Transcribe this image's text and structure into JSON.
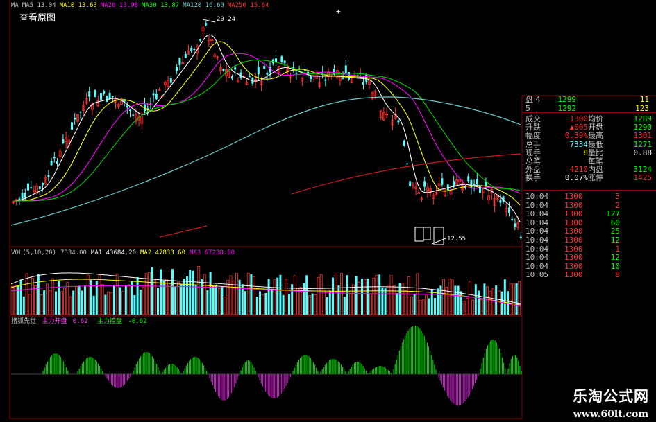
{
  "price_header": {
    "items": [
      {
        "label": "MA",
        "color": "#c0c0c0"
      },
      {
        "label": "MA5 13.04",
        "color": "#c0c0c0"
      },
      {
        "label": "MA10 13.63",
        "color": "#ffff00"
      },
      {
        "label": "MA20 13.98",
        "color": "#ff00ff"
      },
      {
        "label": "MA30 13.87",
        "color": "#00ff00"
      },
      {
        "label": "MA120 16.60",
        "color": "#7fd2d2"
      },
      {
        "label": "MA250 15.64",
        "color": "#ff3030"
      }
    ]
  },
  "view_original_label": "查看原图",
  "high_label": "20.24",
  "low_label": "12.55",
  "vol_header": {
    "items": [
      {
        "label": "VOL(5,10,20)",
        "color": "#c0c0c0"
      },
      {
        "label": "7334.00",
        "color": "#c0c0c0"
      },
      {
        "label": "MA1 43684.20",
        "color": "#ffffff"
      },
      {
        "label": "MA2 47833.60",
        "color": "#ffff00"
      },
      {
        "label": "MA3 67238.60",
        "color": "#ff00ff"
      }
    ]
  },
  "ind_header": {
    "name": "猎狐先觉",
    "buy_label": "主力开盘",
    "buy_value": "0.62",
    "sell_label": "主力控盘",
    "sell_value": "-0.62"
  },
  "colors": {
    "up": "#ff3232",
    "down": "#54ffff",
    "grid": "#8b0000",
    "green": "#00d000",
    "magenta": "#c020c0"
  },
  "quote": {
    "orders": [
      {
        "label": "盘",
        "level": "4",
        "price": "1299",
        "qty": "11"
      },
      {
        "label": "",
        "level": "5",
        "price": "1292",
        "qty": "123"
      }
    ],
    "stats": [
      {
        "l1": "成交",
        "v1": "1300",
        "l2": "均价",
        "v2": "1289",
        "c1": "#ff3030",
        "c2": "#00ff00"
      },
      {
        "l1": "升跌",
        "v1": "▲005",
        "l2": "开盘",
        "v2": "1290",
        "c1": "#ff3030",
        "c2": "#00ff00"
      },
      {
        "l1": "幅度",
        "v1": "0.39%",
        "l2": "最高",
        "v2": "1301",
        "c1": "#ff3030",
        "c2": "#ff3030"
      },
      {
        "l1": "总手",
        "v1": "7334",
        "l2": "最低",
        "v2": "1271",
        "c1": "#54ffff",
        "c2": "#00ff00"
      },
      {
        "l1": "现手",
        "v1": "8",
        "l2": "量比",
        "v2": "0.88",
        "c1": "#ffff00",
        "c2": "#ffffff"
      },
      {
        "l1": "总笔",
        "v1": "",
        "l2": "每笔",
        "v2": "",
        "c1": "#ffffff",
        "c2": "#ffffff"
      },
      {
        "l1": "外盘",
        "v1": "4210",
        "l2": "内盘",
        "v2": "3124",
        "c1": "#ff3030",
        "c2": "#00ff00"
      },
      {
        "l1": "换手",
        "v1": "0.07%",
        "l2": "涨停",
        "v2": "1425",
        "c1": "#ffffff",
        "c2": "#ff3030"
      }
    ],
    "ticks": [
      {
        "time": "10:04",
        "price": "1300",
        "qty": "3"
      },
      {
        "time": "10:04",
        "price": "1300",
        "qty": "2"
      },
      {
        "time": "10:04",
        "price": "1300",
        "qty": "127"
      },
      {
        "time": "10:04",
        "price": "1300",
        "qty": "60"
      },
      {
        "time": "10:04",
        "price": "1300",
        "qty": "25"
      },
      {
        "time": "10:04",
        "price": "1300",
        "qty": "12"
      },
      {
        "time": "10:04",
        "price": "1300",
        "qty": "1"
      },
      {
        "time": "10:04",
        "price": "1300",
        "qty": "12"
      },
      {
        "time": "10:04",
        "price": "1300",
        "qty": "10"
      },
      {
        "time": "10:05",
        "price": "1300",
        "qty": "8"
      }
    ]
  },
  "watermark": {
    "title": "乐淘公式网",
    "url": "www.60lt.com"
  },
  "chart_data": [
    {
      "type": "candlestick",
      "title": "",
      "series": [
        {
          "name": "MA5",
          "values": [
            13.04
          ]
        },
        {
          "name": "MA10",
          "values": [
            13.63
          ]
        },
        {
          "name": "MA20",
          "values": [
            13.98
          ]
        },
        {
          "name": "MA30",
          "values": [
            13.87
          ]
        },
        {
          "name": "MA120",
          "values": [
            16.6
          ]
        },
        {
          "name": "MA250",
          "values": [
            15.64
          ]
        }
      ],
      "annotations": [
        "20.24",
        "12.55"
      ],
      "high": 20.24,
      "low": 12.55
    },
    {
      "type": "bar",
      "title": "VOL(5,10,20)",
      "series": [
        {
          "name": "MA1",
          "values": [
            43684.2
          ]
        },
        {
          "name": "MA2",
          "values": [
            47833.6
          ]
        },
        {
          "name": "MA3",
          "values": [
            67238.6
          ]
        }
      ],
      "last_volume": 7334.0
    },
    {
      "type": "bar",
      "title": "猎狐先觉",
      "series": [
        {
          "name": "主力开盘",
          "values": [
            0.62
          ]
        },
        {
          "name": "主力控盘",
          "values": [
            -0.62
          ]
        }
      ]
    }
  ]
}
